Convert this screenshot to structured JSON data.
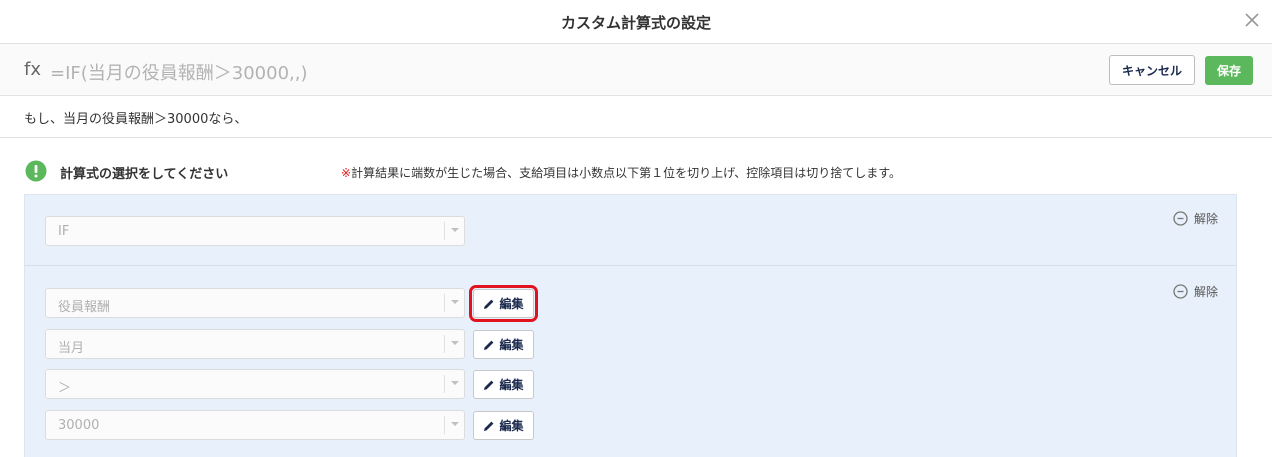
{
  "dialog": {
    "title": "カスタム計算式の設定",
    "close_icon": "close-icon"
  },
  "formula": {
    "prefix": "fx",
    "text": "=IF(当月の役員報酬＞30000,,)",
    "cancel_label": "キャンセル",
    "save_label": "保存"
  },
  "description": "もし、当月の役員報酬＞30000なら、",
  "section": {
    "title": "計算式の選択をしてください",
    "note_mark": "※",
    "note": "計算結果に端数が生じた場合、支給項目は小数点以下第１位を切り上げ、控除項目は切り捨てします。"
  },
  "blocks": [
    {
      "remove_label": "解除",
      "rows": [
        {
          "value": "IF",
          "editable": false
        }
      ]
    },
    {
      "remove_label": "解除",
      "rows": [
        {
          "value": "役員報酬",
          "edit_label": "編集"
        },
        {
          "value": "当月",
          "edit_label": "編集"
        },
        {
          "value": "＞",
          "edit_label": "編集"
        },
        {
          "value": "30000",
          "edit_label": "編集"
        }
      ]
    }
  ],
  "colors": {
    "accent_green": "#5cb85c",
    "panel_bg": "#e8f0fb",
    "highlight_red": "#e0141e",
    "note_mark_red": "#e02020"
  }
}
